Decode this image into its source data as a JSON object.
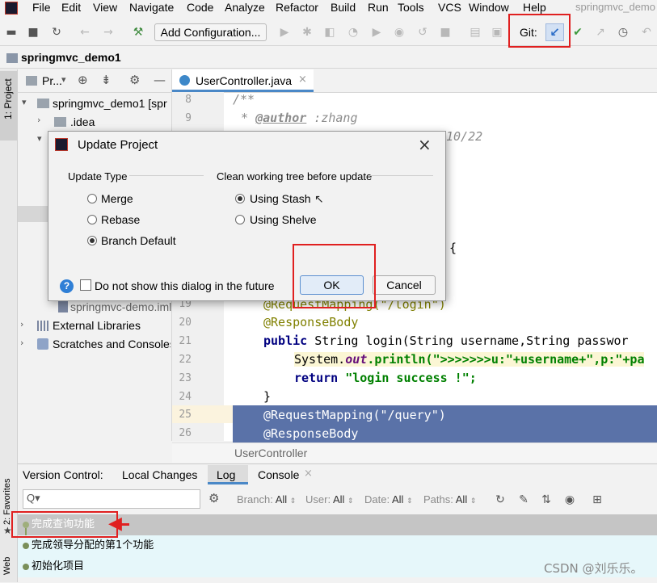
{
  "menubar": {
    "items": [
      "File",
      "Edit",
      "View",
      "Navigate",
      "Code",
      "Analyze",
      "Refactor",
      "Build",
      "Run",
      "Tools",
      "VCS",
      "Window",
      "Help"
    ],
    "window_title": "springmvc_demo"
  },
  "toolbar": {
    "add_configuration": "Add Configuration...",
    "git_label": "Git:"
  },
  "breadcrumb": {
    "project": "springmvc_demo1"
  },
  "left_strip": {
    "project": "1: Project",
    "favorites": "2: Favorites",
    "web": "Web"
  },
  "project_panel": {
    "header": "Pr...",
    "tree": {
      "root": "springmvc_demo1 [spr",
      "idea": ".idea",
      "iml": "springmvc-demo.iml",
      "external_libraries": "External Libraries",
      "scratches": "Scratches and Consoles"
    }
  },
  "editor": {
    "tab": "UserController.java",
    "footer": "UserController",
    "line_numbers": [
      "8",
      "9",
      "19",
      "20",
      "21",
      "22",
      "23",
      "24",
      "25",
      "26"
    ],
    "lines": {
      "l8": "/**",
      "l9_star": "* ",
      "l9_tag": "@author",
      "l9_rest": "  :zhang",
      "l10_frag": "10/22",
      "l18_frag": "{",
      "l19": "@RequestMapping(\"/login\")",
      "l20": "@ResponseBody",
      "l21_kw": "public",
      "l21_rest": " String login(String username,String passwor",
      "l22_sys": "System.",
      "l22_out": "out",
      "l22_rest": ".println(\">>>>>>>u:\"+username+\",p:\"+pa",
      "l23_kw": "return",
      "l23_str": " \"login success !\";",
      "l24": "}",
      "l25": "@RequestMapping(\"/query\")",
      "l26": "@ResponseBody"
    }
  },
  "dialog": {
    "title": "Update Project",
    "update_type_label": "Update Type",
    "update_types": [
      "Merge",
      "Rebase",
      "Branch Default"
    ],
    "selected_update_type": "Branch Default",
    "clean_label": "Clean working tree before update",
    "clean_options": [
      "Using Stash",
      "Using Shelve"
    ],
    "selected_clean_option": "Using Stash",
    "dont_show_label": "Do not show this dialog in the future",
    "dont_show_checked": false,
    "ok_label": "OK",
    "cancel_label": "Cancel",
    "help_icon_text": "?"
  },
  "vcs": {
    "tabs": {
      "version_control": "Version Control:",
      "local_changes": "Local Changes",
      "log": "Log",
      "console": "Console"
    },
    "active_tab": "Log",
    "search_placeholder": "Q▾",
    "filters": {
      "branch_label": "Branch:",
      "branch_value": "All",
      "user_label": "User:",
      "user_value": "All",
      "date_label": "Date:",
      "date_value": "All",
      "paths_label": "Paths:",
      "paths_value": "All"
    },
    "commits": [
      "完成查询功能",
      "完成领导分配的第1个功能",
      "初始化项目"
    ],
    "selected_commit": "完成查询功能"
  },
  "watermark": "CSDN @刘乐乐。",
  "colors": {
    "accent_red": "#e02020",
    "selection": "#5a72a8",
    "commit_bg": "#e6f7fa"
  }
}
